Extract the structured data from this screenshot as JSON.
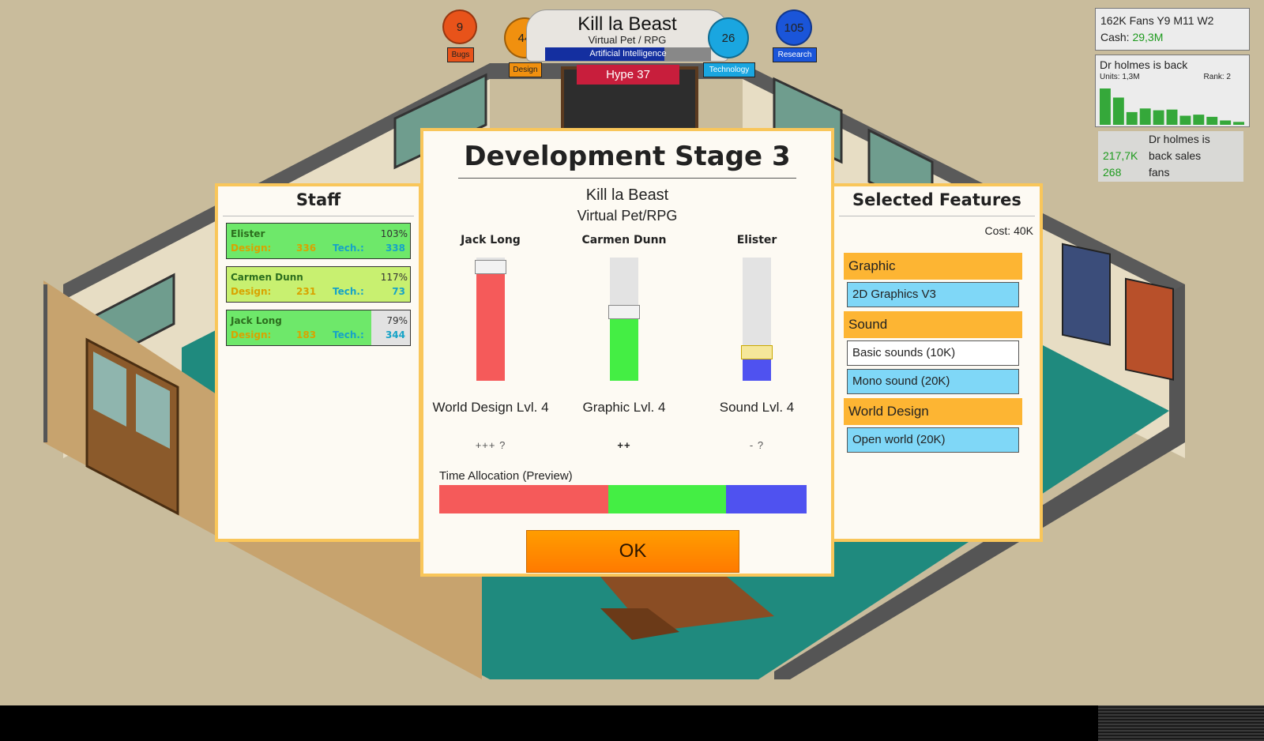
{
  "hud": {
    "game_title": "Kill la Beast",
    "game_genre": "Virtual Pet / RPG",
    "research_topic": "Artificial Intelligence",
    "research_progress": 0.72,
    "hype": "Hype 37",
    "stats": [
      {
        "value": "9",
        "label": "Bugs",
        "color": "#e8531a"
      },
      {
        "value": "44",
        "label": "Design",
        "color": "#f0900f"
      },
      {
        "value": "26",
        "label": "Technology",
        "color": "#1aa6e0"
      },
      {
        "value": "105",
        "label": "Research",
        "color": "#1a55d9"
      }
    ]
  },
  "company": {
    "fans_date": "162K Fans Y9 M11 W2",
    "cash_label": "Cash:",
    "cash_value": "29,3M"
  },
  "sales": {
    "game": "Dr holmes is back",
    "units": "Units: 1,3M",
    "rank": "Rank: 2",
    "weekly_relative": [
      1.0,
      0.75,
      0.35,
      0.45,
      0.4,
      0.42,
      0.25,
      0.28,
      0.22,
      0.12,
      0.08
    ],
    "summary_sales": "217,7K",
    "summary_fans": "268",
    "summary_label_1": "Dr holmes is",
    "summary_label_2": "back sales",
    "summary_label_3": "fans"
  },
  "staff_panel": {
    "title": "Staff",
    "design_label": "Design:",
    "tech_label": "Tech.:",
    "members": [
      {
        "name": "Elister",
        "percent": "103%",
        "design": "336",
        "tech": "338",
        "fill": 1.0,
        "color": "#6ee86a"
      },
      {
        "name": "Carmen Dunn",
        "percent": "117%",
        "design": "231",
        "tech": "73",
        "fill": 1.0,
        "color": "#c8f070"
      },
      {
        "name": "Jack Long",
        "percent": "79%",
        "design": "183",
        "tech": "344",
        "fill": 0.79,
        "color": "#6ee86a"
      }
    ]
  },
  "dev_panel": {
    "title": "Development Stage 3",
    "game": "Kill la Beast",
    "genre": "Virtual Pet/RPG",
    "columns": [
      {
        "assignee": "Jack Long",
        "focus": "World Design Lvl. 4",
        "rating": "+++ ?",
        "level": 0.92,
        "color": "#f55a5a"
      },
      {
        "assignee": "Carmen Dunn",
        "focus": "Graphic Lvl. 4",
        "rating": "++",
        "level": 0.56,
        "color": "#44ee44"
      },
      {
        "assignee": "Elister",
        "focus": "Sound Lvl. 4",
        "rating": "- ?",
        "level": 0.23,
        "color": "#4f52f0"
      }
    ],
    "time_allocation_label": "Time Allocation (Preview)",
    "time_allocation": [
      0.46,
      0.32,
      0.22
    ],
    "ok_label": "OK"
  },
  "features_panel": {
    "title": "Selected Features",
    "cost": "Cost: 40K",
    "categories": [
      {
        "name": "Graphic",
        "items": [
          {
            "label": "2D Graphics V3",
            "selected": true
          }
        ]
      },
      {
        "name": "Sound",
        "items": [
          {
            "label": "Basic sounds (10K)",
            "selected": false
          },
          {
            "label": "Mono sound (20K)",
            "selected": true
          }
        ]
      },
      {
        "name": "World Design",
        "items": [
          {
            "label": "Open world (20K)",
            "selected": true
          }
        ]
      }
    ],
    "selected_color": "#7fd7f7",
    "unselected_color": "#ffffff"
  }
}
